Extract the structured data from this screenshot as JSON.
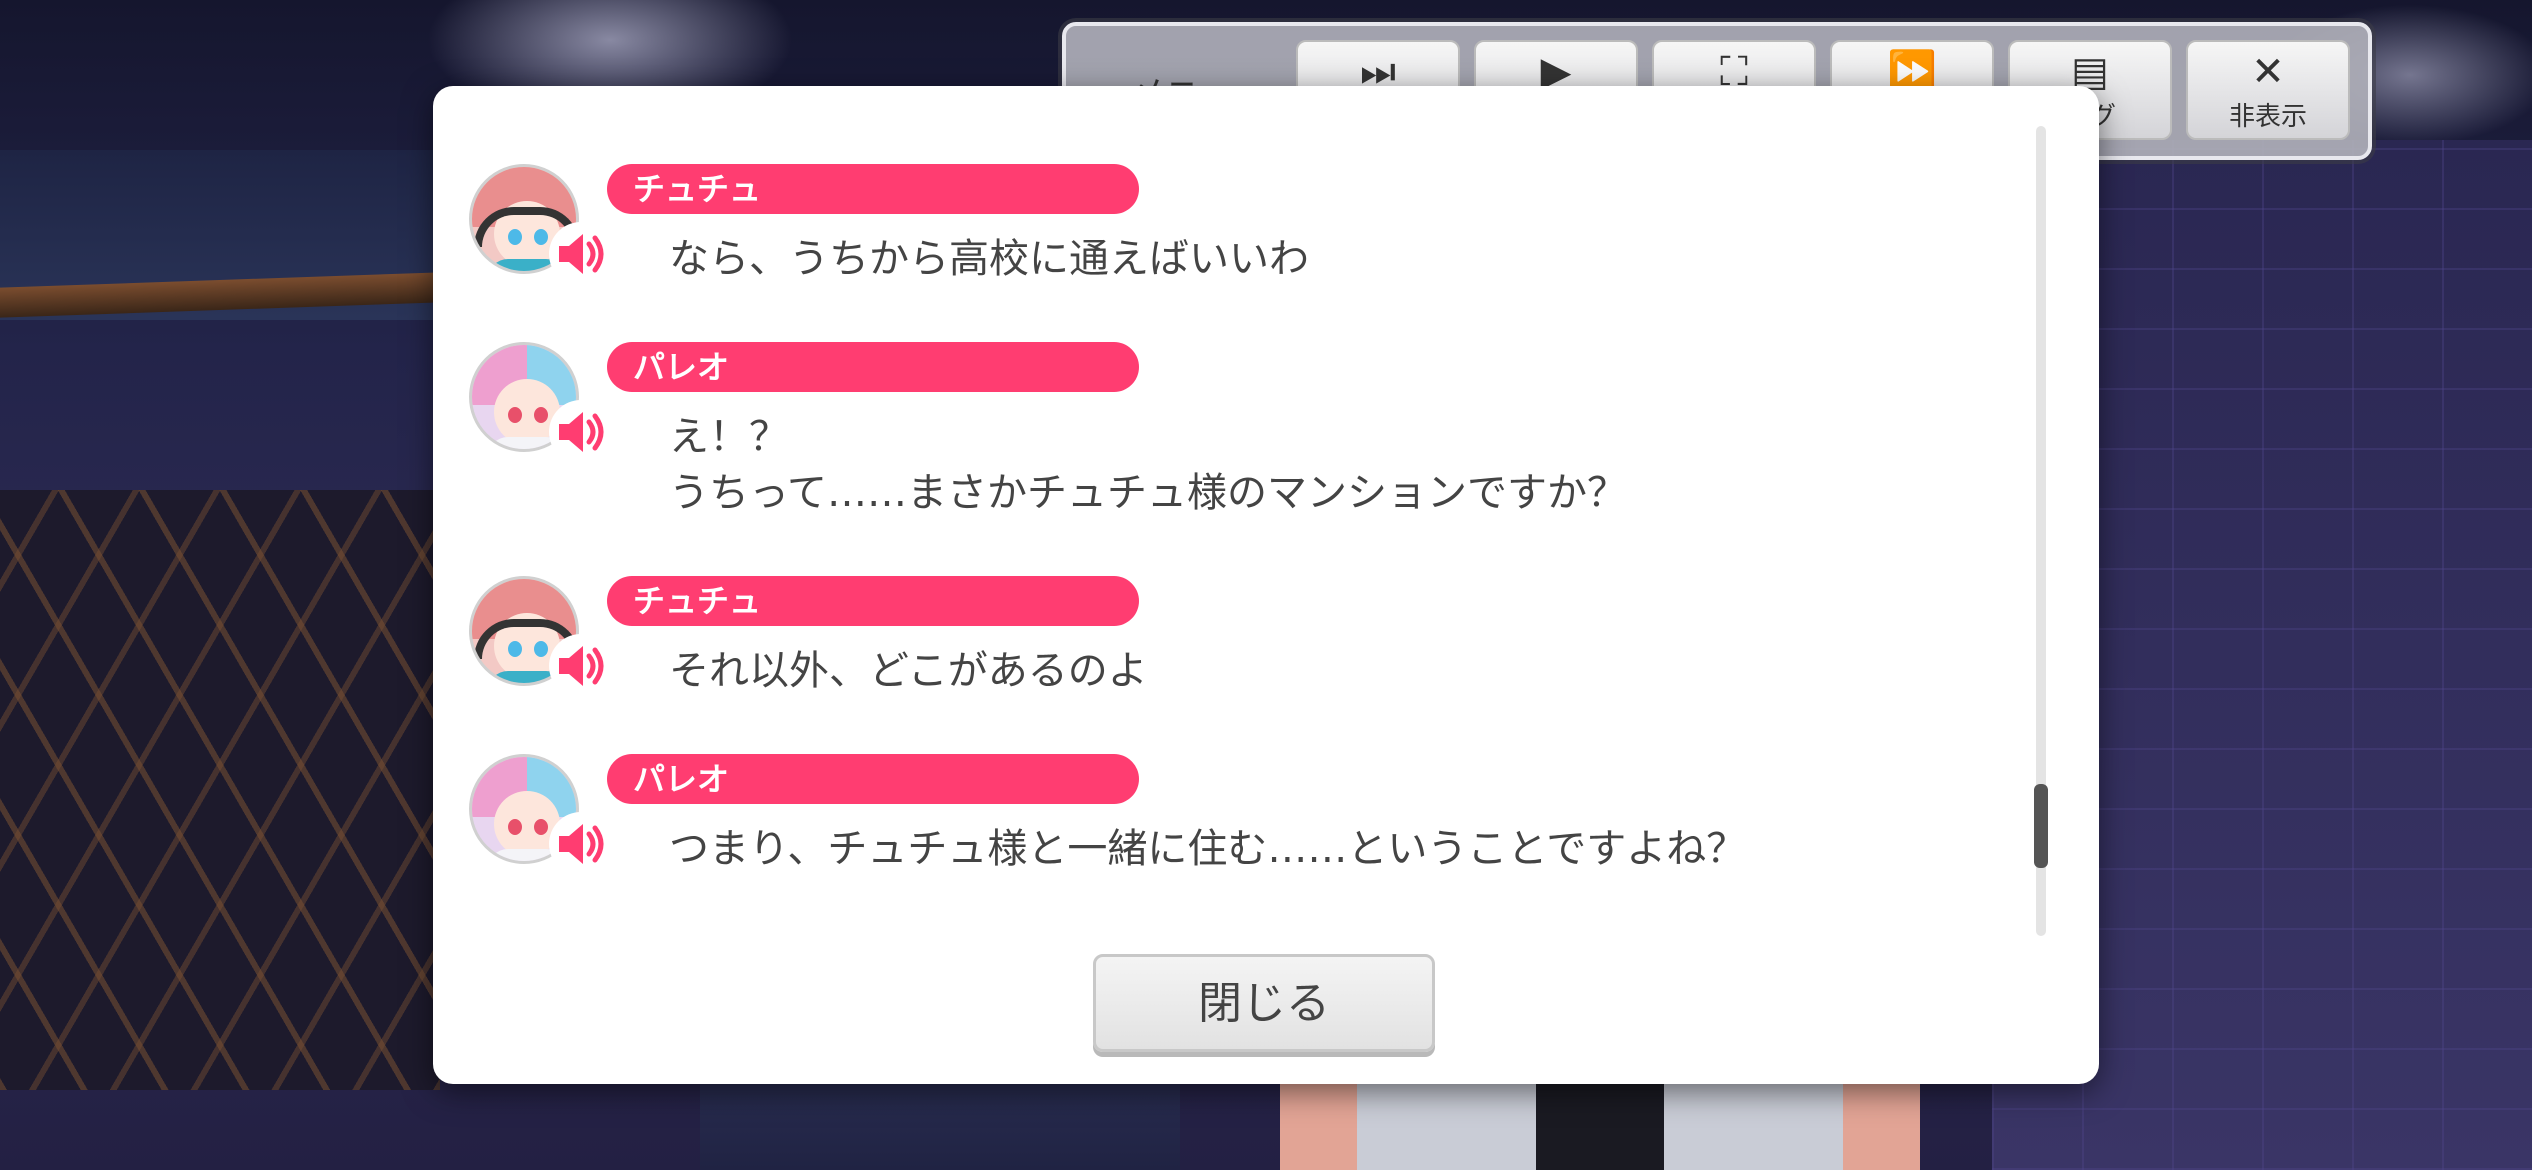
{
  "toolbar": {
    "menu_label": "メニュー",
    "buttons": [
      {
        "icon": "skip-to-end-icon",
        "glyph": "⏭",
        "label": ""
      },
      {
        "icon": "play-icon",
        "glyph": "▶",
        "label": ""
      },
      {
        "icon": "full-screen-icon",
        "glyph": "⛶",
        "label": ""
      },
      {
        "icon": "fast-forward-icon",
        "glyph": "⏩",
        "label": ""
      },
      {
        "icon": "log-icon",
        "glyph": "▤",
        "label": "ログ"
      },
      {
        "icon": "close-icon",
        "glyph": "✕",
        "label": "非表示"
      }
    ]
  },
  "backlog": {
    "entries": [
      {
        "speaker": "チュチュ",
        "lines": [
          "なら、うちから高校に通えばいいわ"
        ]
      },
      {
        "speaker": "パレオ",
        "lines": [
          "え！？",
          "うちって……まさかチュチュ様のマンションですか？"
        ]
      },
      {
        "speaker": "チュチュ",
        "lines": [
          "それ以外、どこがあるのよ"
        ]
      },
      {
        "speaker": "パレオ",
        "lines": [
          "つまり、チュチュ様と一緒に住む……ということですよね？"
        ]
      }
    ],
    "close_label": "閉じる"
  },
  "colors": {
    "accent": "#ff3d71",
    "dialog_bg": "#ffffff",
    "text": "#444444"
  }
}
